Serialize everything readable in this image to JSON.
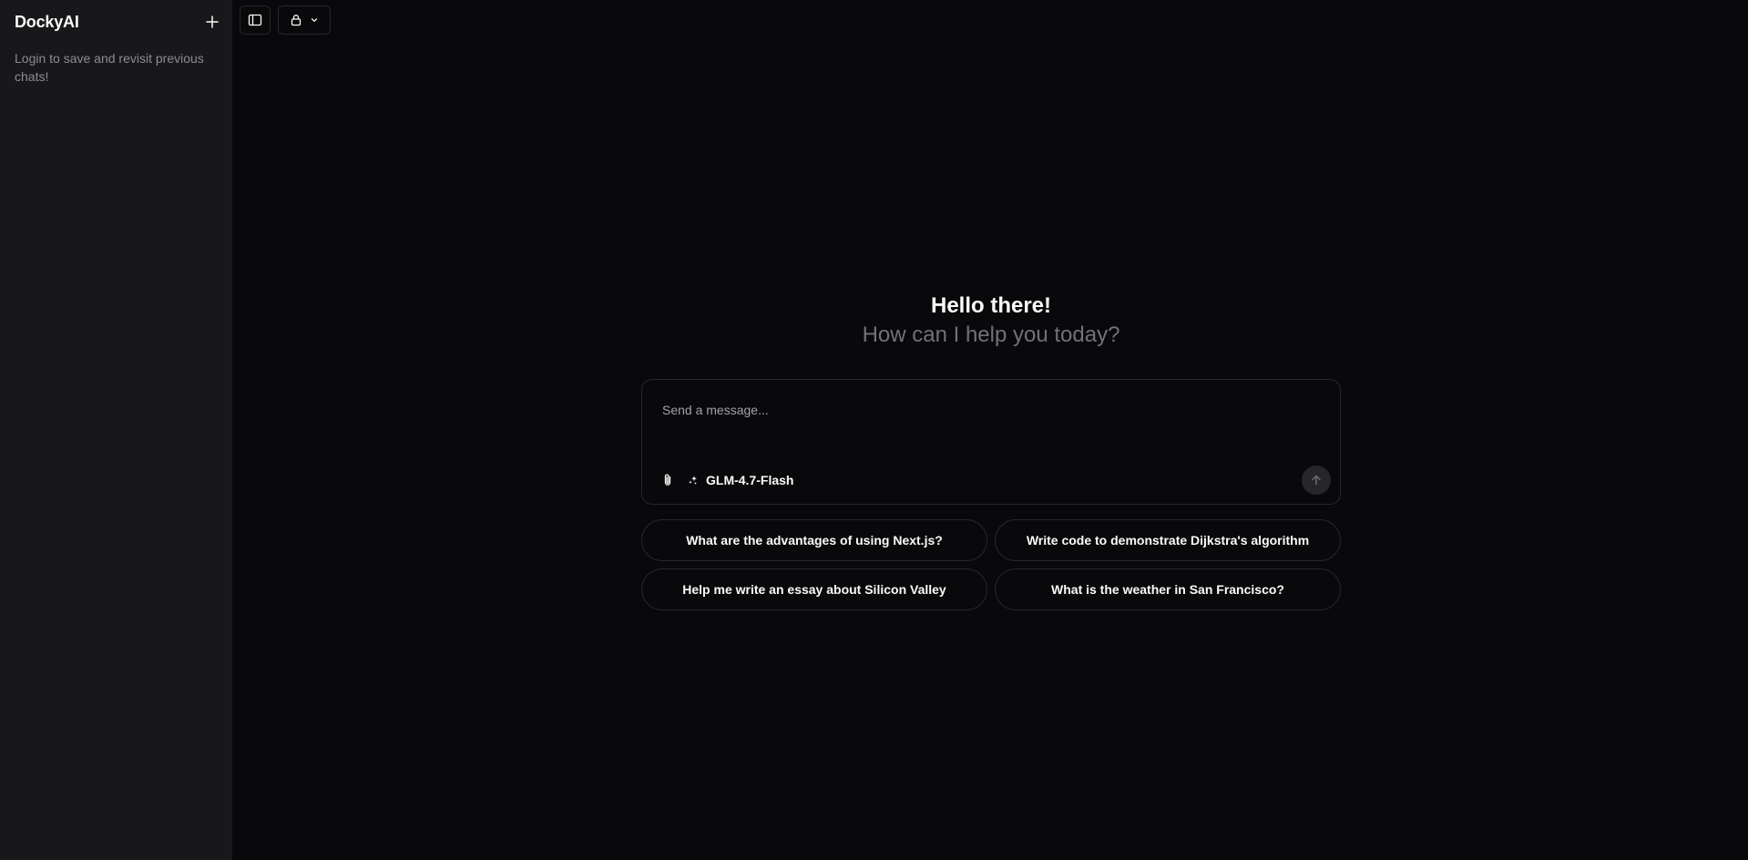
{
  "sidebar": {
    "brand": "DockyAI",
    "note": "Login to save and revisit previous chats!",
    "new_chat_icon": "plus-icon"
  },
  "topbar": {
    "toggle_sidebar_icon": "sidebar-toggle-icon",
    "visibility_icon": "lock-icon",
    "visibility_chevron_icon": "chevron-down-icon"
  },
  "greeting": {
    "title": "Hello there!",
    "subtitle": "How can I help you today?"
  },
  "composer": {
    "placeholder": "Send a message...",
    "value": "",
    "model_name": "GLM-4.7-Flash",
    "attach_icon": "paperclip-icon",
    "model_icon": "sparkles-icon",
    "send_icon": "arrow-up-icon"
  },
  "suggestions": [
    {
      "label": "What are the advantages of using Next.js?"
    },
    {
      "label": "Write code to demonstrate Dijkstra's algorithm"
    },
    {
      "label": "Help me write an essay about Silicon Valley"
    },
    {
      "label": "What is the weather in San Francisco?"
    }
  ],
  "colors": {
    "background": "#09090b",
    "sidebar": "#18181b",
    "border": "#27272a",
    "muted_text": "#71717a"
  }
}
